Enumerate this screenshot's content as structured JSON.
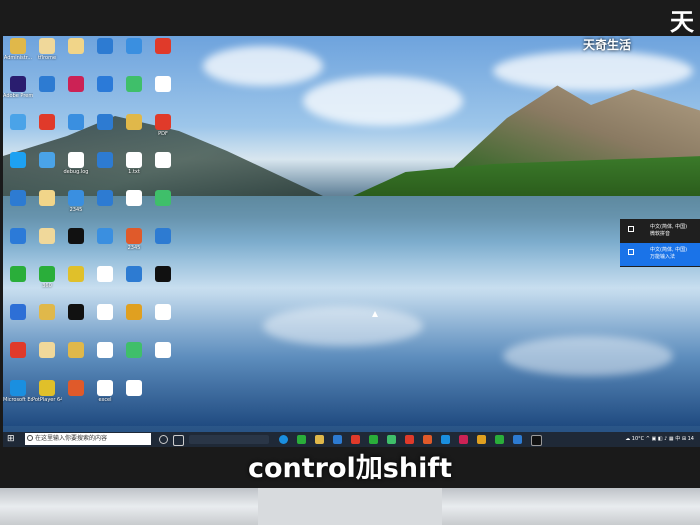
{
  "watermark_top": "天",
  "logo": "天奇生活",
  "subtitle": "control加shift",
  "desktop_icons": [
    {
      "label": "Administr...",
      "color": "#e0b84a"
    },
    {
      "label": "tflrome",
      "color": "#f0d89a"
    },
    {
      "label": "",
      "color": "#f1d589"
    },
    {
      "label": "",
      "color": "#2d7bd2"
    },
    {
      "label": "",
      "color": "#3a8fe0"
    },
    {
      "label": "",
      "color": "#e03a2a"
    },
    {
      "label": "Adobe Premiere",
      "color": "#2a1d6f"
    },
    {
      "label": "",
      "color": "#2d7bd2"
    },
    {
      "label": "",
      "color": "#cc2255"
    },
    {
      "label": "",
      "color": "#2b7ad8"
    },
    {
      "label": "",
      "color": "#3fbf6a"
    },
    {
      "label": "",
      "color": "#ffffff"
    },
    {
      "label": "",
      "color": "#4aa3e8"
    },
    {
      "label": "",
      "color": "#e03a2a"
    },
    {
      "label": "",
      "color": "#3a8fe0"
    },
    {
      "label": "",
      "color": "#2d7bd2"
    },
    {
      "label": "",
      "color": "#e0b84a"
    },
    {
      "label": "PDF",
      "color": "#e03a2a"
    },
    {
      "label": "",
      "color": "#1da1f2"
    },
    {
      "label": "",
      "color": "#4aa3e8"
    },
    {
      "label": "debug.log",
      "color": "#ffffff"
    },
    {
      "label": "",
      "color": "#2d7bd2"
    },
    {
      "label": "1.txt",
      "color": "#ffffff"
    },
    {
      "label": "",
      "color": "#ffffff"
    },
    {
      "label": "",
      "color": "#2d7bd2"
    },
    {
      "label": "",
      "color": "#f1d589"
    },
    {
      "label": "2345",
      "color": "#3a8fe0"
    },
    {
      "label": "",
      "color": "#2d7bd2"
    },
    {
      "label": "",
      "color": "#ffffff"
    },
    {
      "label": "",
      "color": "#3fbf6a"
    },
    {
      "label": "",
      "color": "#2b7ad8"
    },
    {
      "label": "",
      "color": "#f0d89a"
    },
    {
      "label": "",
      "color": "#111111"
    },
    {
      "label": "",
      "color": "#3a8fe0"
    },
    {
      "label": "2345",
      "color": "#e05a2a"
    },
    {
      "label": "",
      "color": "#2d7bd2"
    },
    {
      "label": "",
      "color": "#2aae3a"
    },
    {
      "label": "360",
      "color": "#2aae3a"
    },
    {
      "label": "",
      "color": "#e0c02a"
    },
    {
      "label": "",
      "color": "#ffffff"
    },
    {
      "label": "",
      "color": "#2d7bd2"
    },
    {
      "label": "",
      "color": "#111111"
    },
    {
      "label": "",
      "color": "#2d6fd6"
    },
    {
      "label": "",
      "color": "#e0b84a"
    },
    {
      "label": "",
      "color": "#111111"
    },
    {
      "label": "",
      "color": "#ffffff"
    },
    {
      "label": "",
      "color": "#e0a020"
    },
    {
      "label": "",
      "color": "#ffffff"
    },
    {
      "label": "",
      "color": "#e03a2a"
    },
    {
      "label": "",
      "color": "#f0d89a"
    },
    {
      "label": "",
      "color": "#e0b84a"
    },
    {
      "label": "",
      "color": "#ffffff"
    },
    {
      "label": "",
      "color": "#3fbf6a"
    },
    {
      "label": "",
      "color": "#ffffff"
    },
    {
      "label": "Microsoft Edge",
      "color": "#1a8fe0"
    },
    {
      "label": "PotPlayer 64 bit",
      "color": "#e0c02a"
    },
    {
      "label": "",
      "color": "#e05a2a"
    },
    {
      "label": "excel",
      "color": "#ffffff"
    },
    {
      "label": "",
      "color": "#ffffff"
    }
  ],
  "taskbar": {
    "search_placeholder": "在这里输入你要搜索的内容",
    "temperature": "10°C",
    "time": "14",
    "date": "2022"
  },
  "ime_popup": {
    "items": [
      {
        "lang": "中文(简体, 中国)",
        "name": "微软拼音"
      },
      {
        "lang": "中文(简体, 中国)",
        "name": "万能输入法"
      }
    ]
  }
}
